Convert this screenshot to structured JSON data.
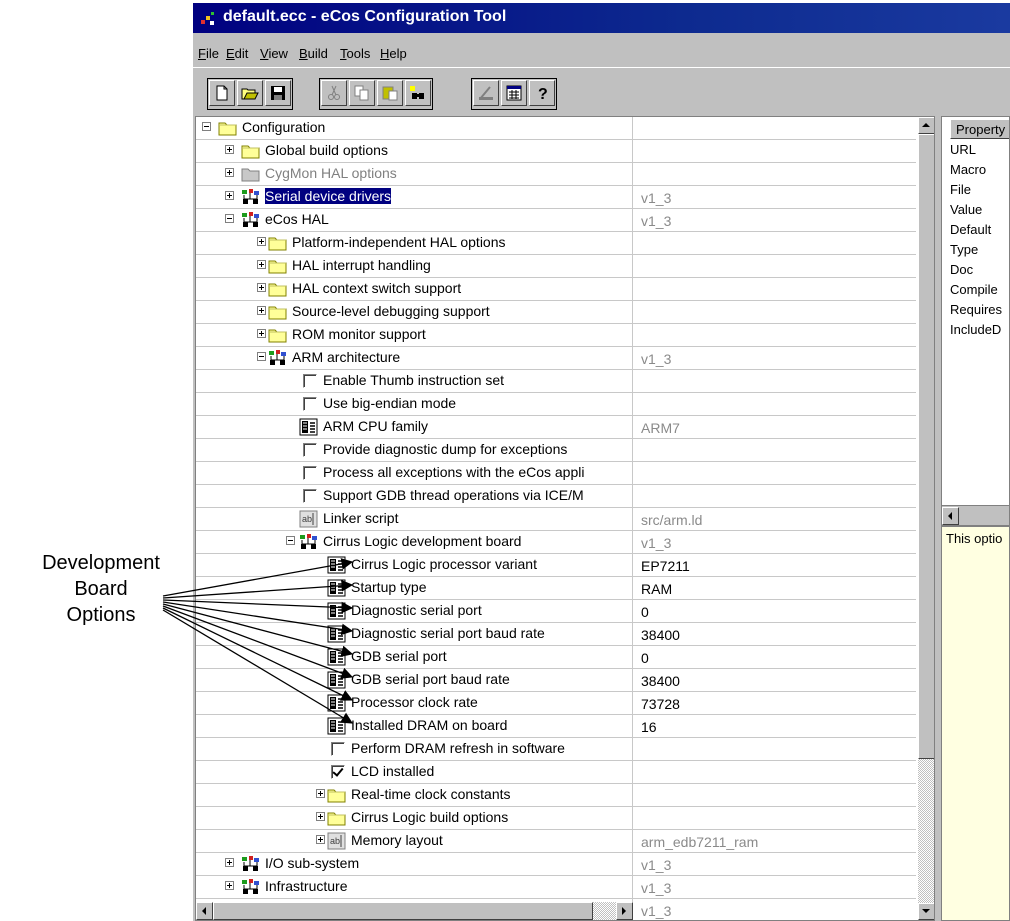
{
  "window": {
    "title": "default.ecc - eCos Configuration Tool"
  },
  "menu": {
    "items": [
      "File",
      "Edit",
      "View",
      "Build",
      "Tools",
      "Help"
    ]
  },
  "toolbar": {
    "icons": [
      "new-file-icon",
      "open-folder-icon",
      "save-disk-icon",
      "cut-icon",
      "copy-icon",
      "paste-icon",
      "find-icon",
      "run-icon",
      "build-icon",
      "help-icon"
    ]
  },
  "tree": {
    "rows": [
      {
        "label": "Configuration",
        "value": "",
        "indent": 0,
        "exp": "minus",
        "icon": "folder"
      },
      {
        "label": "Global build options",
        "value": "",
        "indent": 1,
        "exp": "plus",
        "icon": "folder"
      },
      {
        "label": "CygMon HAL options",
        "value": "",
        "indent": 1,
        "exp": "plus",
        "icon": "folder-gray",
        "gray": true
      },
      {
        "label": "Serial device drivers",
        "value": "v1_3",
        "indent": 1,
        "exp": "plus",
        "icon": "package",
        "selected": true
      },
      {
        "label": "eCos HAL",
        "value": "v1_3",
        "indent": 1,
        "exp": "minus",
        "icon": "package"
      },
      {
        "label": "Platform-independent HAL options",
        "value": "",
        "indent": 2,
        "exp": "plus",
        "icon": "folder"
      },
      {
        "label": "HAL interrupt handling",
        "value": "",
        "indent": 2,
        "exp": "plus",
        "icon": "folder"
      },
      {
        "label": "HAL context switch support",
        "value": "",
        "indent": 2,
        "exp": "plus",
        "icon": "folder"
      },
      {
        "label": "Source-level debugging support",
        "value": "",
        "indent": 2,
        "exp": "plus",
        "icon": "folder"
      },
      {
        "label": "ROM monitor support",
        "value": "",
        "indent": 2,
        "exp": "plus",
        "icon": "folder"
      },
      {
        "label": "ARM architecture",
        "value": "v1_3",
        "indent": 2,
        "exp": "minus",
        "icon": "package"
      },
      {
        "label": "Enable Thumb instruction set",
        "value": "",
        "indent": 3,
        "icon": "checkbox"
      },
      {
        "label": "Use big-endian mode",
        "value": "",
        "indent": 3,
        "icon": "checkbox"
      },
      {
        "label": "ARM CPU family",
        "value": "ARM7",
        "indent": 3,
        "icon": "enum"
      },
      {
        "label": "Provide diagnostic dump for exceptions",
        "value": "",
        "indent": 3,
        "icon": "checkbox"
      },
      {
        "label": "Process all exceptions with the eCos appli",
        "value": "",
        "indent": 3,
        "icon": "checkbox"
      },
      {
        "label": "Support GDB thread operations via ICE/M",
        "value": "",
        "indent": 3,
        "icon": "checkbox"
      },
      {
        "label": "Linker script",
        "value": "src/arm.ld",
        "indent": 3,
        "icon": "text"
      },
      {
        "label": "Cirrus Logic development board",
        "value": "v1_3",
        "indent": 3,
        "exp": "minus",
        "icon": "package"
      },
      {
        "label": "Cirrus Logic processor variant",
        "value": "EP7211",
        "indent": 4,
        "icon": "enum",
        "valDark": true
      },
      {
        "label": "Startup type",
        "value": "RAM",
        "indent": 4,
        "icon": "enum",
        "valDark": true
      },
      {
        "label": "Diagnostic serial port",
        "value": "0",
        "indent": 4,
        "icon": "enum",
        "valDark": true
      },
      {
        "label": "Diagnostic serial port baud rate",
        "value": "38400",
        "indent": 4,
        "icon": "enum",
        "valDark": true
      },
      {
        "label": "GDB serial port",
        "value": "0",
        "indent": 4,
        "icon": "enum",
        "valDark": true
      },
      {
        "label": "GDB serial port baud rate",
        "value": "38400",
        "indent": 4,
        "icon": "enum",
        "valDark": true
      },
      {
        "label": "Processor clock rate",
        "value": "73728",
        "indent": 4,
        "icon": "enum",
        "valDark": true
      },
      {
        "label": "Installed DRAM on board",
        "value": "16",
        "indent": 4,
        "icon": "enum",
        "valDark": true
      },
      {
        "label": "Perform DRAM refresh in software",
        "value": "",
        "indent": 4,
        "icon": "checkbox"
      },
      {
        "label": "LCD installed",
        "value": "",
        "indent": 4,
        "icon": "checkbox",
        "checked": true
      },
      {
        "label": "Real-time clock constants",
        "value": "",
        "indent": 4,
        "exp": "plus",
        "icon": "folder"
      },
      {
        "label": "Cirrus Logic build options",
        "value": "",
        "indent": 4,
        "exp": "plus",
        "icon": "folder"
      },
      {
        "label": "Memory layout",
        "value": "arm_edb7211_ram",
        "indent": 4,
        "exp": "plus",
        "icon": "text"
      },
      {
        "label": "I/O sub-system",
        "value": "v1_3",
        "indent": 1,
        "exp": "plus",
        "icon": "package"
      },
      {
        "label": "Infrastructure",
        "value": "v1_3",
        "indent": 1,
        "exp": "plus",
        "icon": "package"
      },
      {
        "label": "",
        "value": "v1_3",
        "indent": 1,
        "icon": "none"
      }
    ]
  },
  "properties": {
    "header": "Property",
    "rows": [
      "URL",
      "Macro",
      "File",
      "Value",
      "Default",
      "Type",
      "Doc",
      "Compile",
      "Requires",
      "IncludeD"
    ]
  },
  "description": {
    "text": "This optio"
  },
  "annotation": {
    "line1": "Development",
    "line2": "Board",
    "line3": "Options"
  }
}
